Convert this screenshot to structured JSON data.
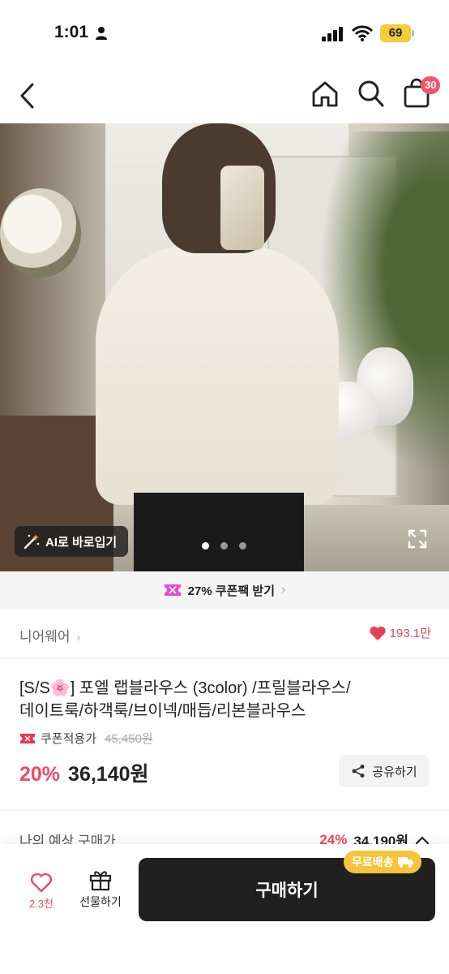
{
  "status_bar": {
    "time": "1:01",
    "battery": "69"
  },
  "nav": {
    "cart_count": "30"
  },
  "hero": {
    "ai_button_label": "AI로 바로입기",
    "slide_total": 3,
    "slide_active": 1
  },
  "coupon_banner": {
    "label": "27% 쿠폰팩 받기"
  },
  "brand": {
    "name": "니어웨어",
    "likes": "193.1만"
  },
  "product": {
    "title_line1": "[S/S🌸] 포엘 랩블라우스 (3color) /프릴블라우스/",
    "title_line2": "데이트룩/하객룩/브이넥/매듭/리본블라우스",
    "coupon_label": "쿠폰적용가",
    "original_price": "45,450원",
    "discount": "20%",
    "price": "36,140원",
    "share_label": "공유하기"
  },
  "expected_price": {
    "label": "나의 예상 구매가",
    "discount": "24%",
    "price": "34,190원"
  },
  "bottom_bar": {
    "wish_count": "2.3천",
    "gift_label": "선물하기",
    "buy_label": "구매하기",
    "free_shipping": "무료배송"
  },
  "colors": {
    "accent": "#f04b62",
    "badge_yellow": "#f6c43b",
    "buy_button": "#202020"
  }
}
